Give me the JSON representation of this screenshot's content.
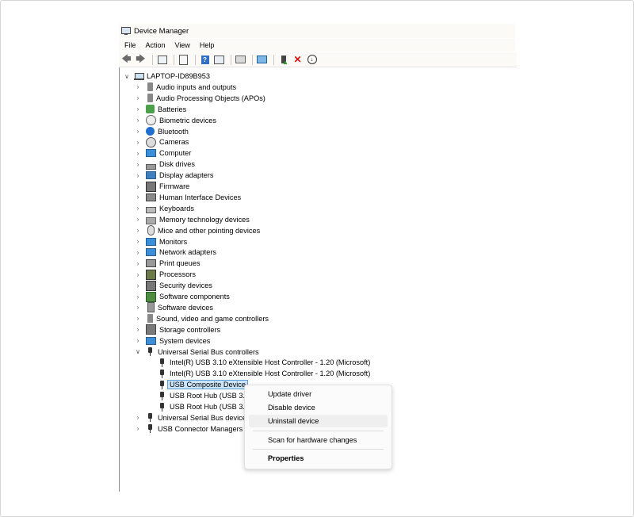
{
  "window": {
    "title": "Device Manager"
  },
  "menubar": [
    "File",
    "Action",
    "View",
    "Help"
  ],
  "toolbar_icons": [
    "back-arrow-icon",
    "forward-arrow-icon",
    "properties-icon",
    "list-icon",
    "help-icon",
    "show-hidden-icon",
    "scan-hardware-icon",
    "monitor-icon",
    "add-driver-icon",
    "uninstall-x-icon",
    "download-icon"
  ],
  "tree": {
    "root": "LAPTOP-ID89B953",
    "categories": [
      {
        "label": "Audio inputs and outputs",
        "icon": "speaker-icon"
      },
      {
        "label": "Audio Processing Objects (APOs)",
        "icon": "speaker-icon"
      },
      {
        "label": "Batteries",
        "icon": "battery-icon"
      },
      {
        "label": "Biometric devices",
        "icon": "fingerprint-icon"
      },
      {
        "label": "Bluetooth",
        "icon": "bluetooth-icon"
      },
      {
        "label": "Cameras",
        "icon": "camera-icon"
      },
      {
        "label": "Computer",
        "icon": "computer-icon"
      },
      {
        "label": "Disk drives",
        "icon": "disk-icon"
      },
      {
        "label": "Display adapters",
        "icon": "display-adapter-icon"
      },
      {
        "label": "Firmware",
        "icon": "firmware-icon"
      },
      {
        "label": "Human Interface Devices",
        "icon": "hid-icon"
      },
      {
        "label": "Keyboards",
        "icon": "keyboard-icon"
      },
      {
        "label": "Memory technology devices",
        "icon": "memory-icon"
      },
      {
        "label": "Mice and other pointing devices",
        "icon": "mouse-icon"
      },
      {
        "label": "Monitors",
        "icon": "monitor-icon"
      },
      {
        "label": "Network adapters",
        "icon": "network-icon"
      },
      {
        "label": "Print queues",
        "icon": "printer-icon"
      },
      {
        "label": "Processors",
        "icon": "processor-icon"
      },
      {
        "label": "Security devices",
        "icon": "security-icon"
      },
      {
        "label": "Software components",
        "icon": "software-component-icon"
      },
      {
        "label": "Software devices",
        "icon": "software-device-icon"
      },
      {
        "label": "Sound, video and game controllers",
        "icon": "sound-icon"
      },
      {
        "label": "Storage controllers",
        "icon": "storage-icon"
      },
      {
        "label": "System devices",
        "icon": "system-icon"
      }
    ],
    "usb_category": "Universal Serial Bus controllers",
    "usb_children": [
      "Intel(R) USB 3.10 eXtensible Host Controller - 1.20 (Microsoft)",
      "Intel(R) USB 3.10 eXtensible Host Controller - 1.20 (Microsoft)",
      "USB Composite Device",
      "USB Root Hub (USB 3.0",
      "USB Root Hub (USB 3.0"
    ],
    "after": [
      {
        "label": "Universal Serial Bus devices",
        "icon": "usb-icon"
      },
      {
        "label": "USB Connector Managers",
        "icon": "usb-icon"
      }
    ]
  },
  "context_menu": {
    "update": "Update driver",
    "disable": "Disable device",
    "uninstall": "Uninstall device",
    "scan": "Scan for hardware changes",
    "properties": "Properties"
  }
}
